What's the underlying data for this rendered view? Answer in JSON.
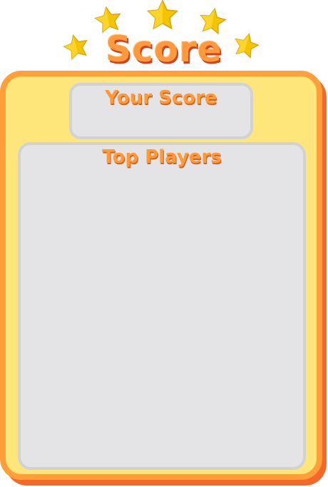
{
  "header": {
    "title": "Score",
    "star_icon": "star-icon",
    "star_color": "#f5c400"
  },
  "your_score": {
    "label": "Your Score"
  },
  "top_players": {
    "label": "Top Players"
  },
  "colors": {
    "panel_fill": "#ffe67a",
    "panel_border": "#ff9f3a",
    "panel_shadow": "#f4682a",
    "box_fill": "#e4e4e6",
    "box_border": "#d2d2d4",
    "text_orange": "#ff9a3c"
  }
}
